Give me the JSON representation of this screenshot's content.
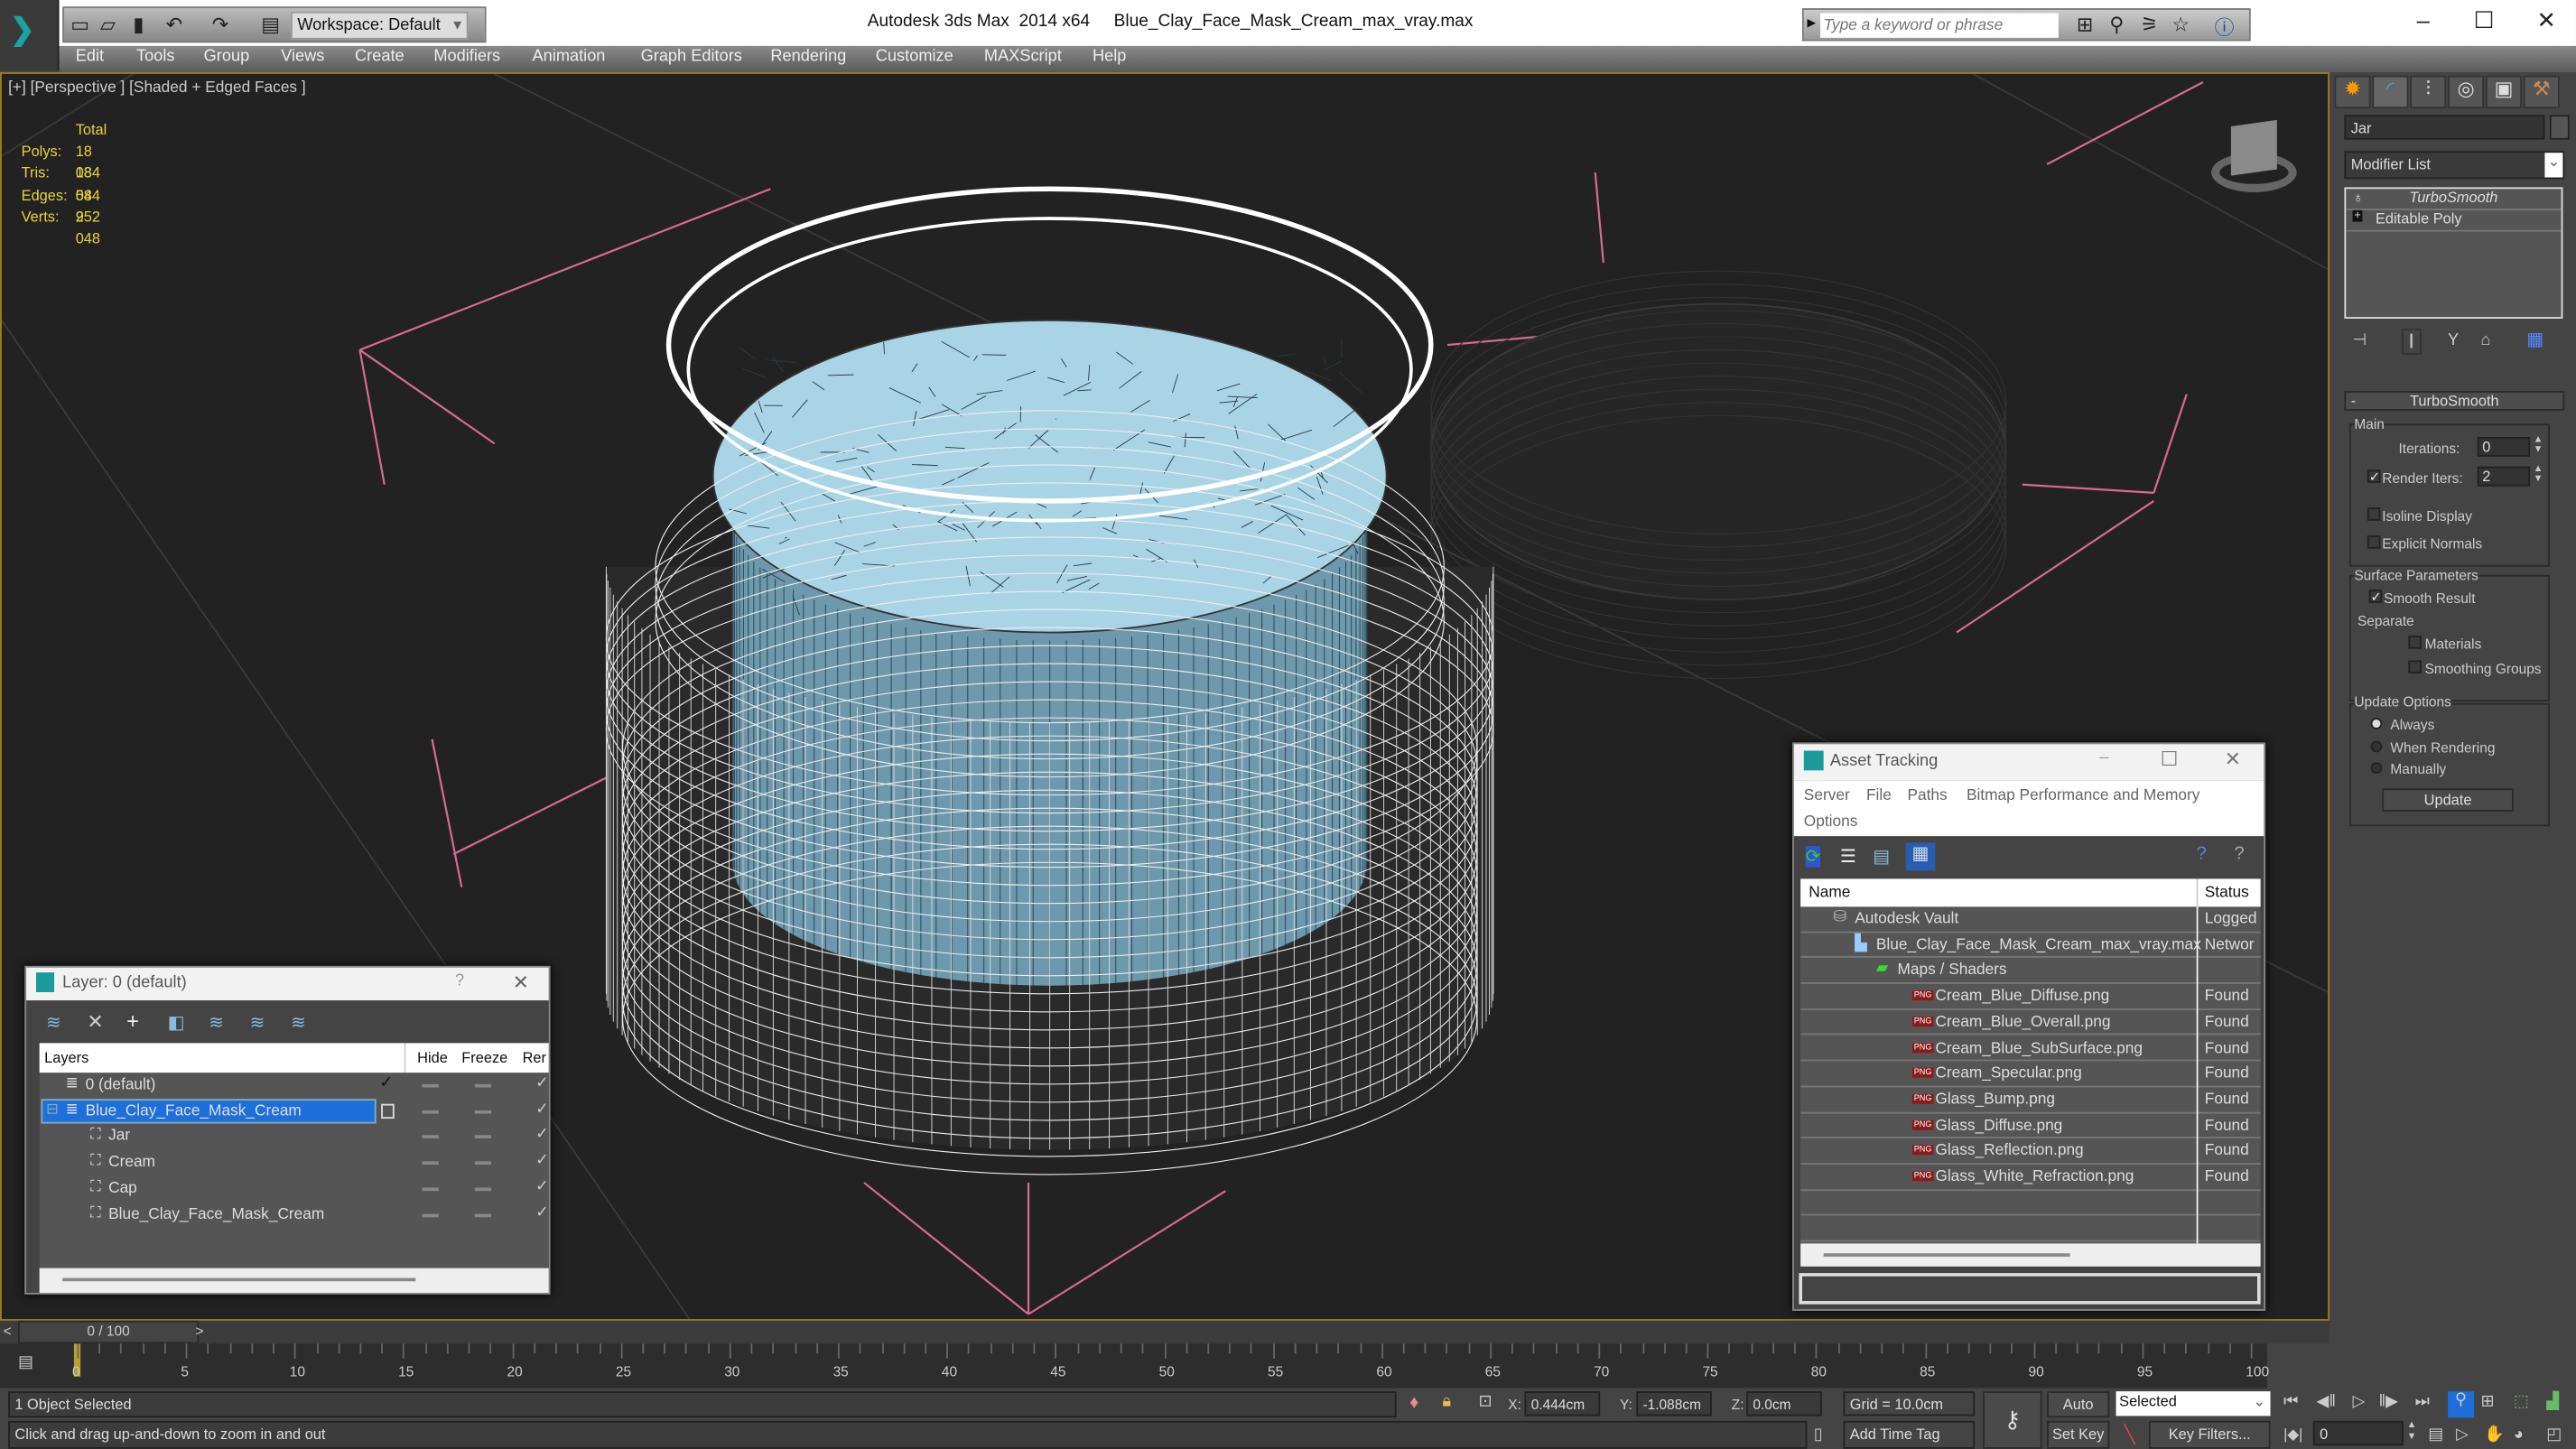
{
  "app": {
    "title": "Autodesk 3ds Max  2014 x64",
    "file": "Blue_Clay_Face_Mask_Cream_max_vray.max",
    "workspace": "Workspace: Default",
    "search_placeholder": "Type a keyword or phrase"
  },
  "menu": [
    "Edit",
    "Tools",
    "Group",
    "Views",
    "Create",
    "Modifiers",
    "Animation",
    "Graph Editors",
    "Rendering",
    "Customize",
    "MAXScript",
    "Help"
  ],
  "viewport": {
    "label": "[+] [Perspective ] [Shaded + Edged Faces ]",
    "stats": {
      "header": "Total",
      "rows": [
        {
          "k": "Polys:",
          "v": "18 084"
        },
        {
          "k": "Tris:",
          "v": "18 084"
        },
        {
          "k": "Edges:",
          "v": "54 252"
        },
        {
          "k": "Verts:",
          "v": "9 048"
        }
      ]
    }
  },
  "command_panel": {
    "object_name": "Jar",
    "modifier_list": "Modifier List",
    "stack": [
      "TurboSmooth",
      "Editable Poly"
    ],
    "rollout": {
      "title": "TurboSmooth",
      "main": "Main",
      "iterations_label": "Iterations:",
      "iterations": "0",
      "render_iters_label": "Render Iters:",
      "render_iters": "2",
      "render_iters_checked": true,
      "isoline": "Isoline Display",
      "explicit_normals": "Explicit Normals",
      "surface": "Surface Parameters",
      "smooth_result": "Smooth Result",
      "smooth_result_checked": true,
      "separate": "Separate",
      "materials": "Materials",
      "smoothing_groups": "Smoothing Groups",
      "update_options": "Update Options",
      "always": "Always",
      "when_rendering": "When Rendering",
      "manually": "Manually",
      "selected_update": "Always",
      "update_btn": "Update"
    }
  },
  "layer_dialog": {
    "title": "Layer: 0 (default)",
    "help": "?",
    "columns": [
      "Layers",
      "Hide",
      "Freeze",
      "Rer"
    ],
    "rows": [
      {
        "name": "0 (default)",
        "level": 0,
        "active": true
      },
      {
        "name": "Blue_Clay_Face_Mask_Cream",
        "level": 0,
        "selected": true
      },
      {
        "name": "Jar",
        "level": 1
      },
      {
        "name": "Cream",
        "level": 1
      },
      {
        "name": "Cap",
        "level": 1
      },
      {
        "name": "Blue_Clay_Face_Mask_Cream",
        "level": 1
      }
    ]
  },
  "asset_tracking": {
    "title": "Asset Tracking",
    "menu": [
      "Server",
      "File",
      "Paths",
      "Bitmap Performance and Memory",
      "Options"
    ],
    "columns": [
      "Name",
      "Status"
    ],
    "rows": [
      {
        "name": "Autodesk Vault",
        "status": "Logged",
        "level": 0,
        "icon": "vault"
      },
      {
        "name": "Blue_Clay_Face_Mask_Cream_max_vray.max",
        "status": "Networ",
        "level": 1,
        "icon": "max"
      },
      {
        "name": "Maps / Shaders",
        "status": "",
        "level": 2,
        "icon": "maps"
      },
      {
        "name": "Cream_Blue_Diffuse.png",
        "status": "Found",
        "level": 3,
        "icon": "png"
      },
      {
        "name": "Cream_Blue_Overall.png",
        "status": "Found",
        "level": 3,
        "icon": "png"
      },
      {
        "name": "Cream_Blue_SubSurface.png",
        "status": "Found",
        "level": 3,
        "icon": "png"
      },
      {
        "name": "Cream_Specular.png",
        "status": "Found",
        "level": 3,
        "icon": "png"
      },
      {
        "name": "Glass_Bump.png",
        "status": "Found",
        "level": 3,
        "icon": "png"
      },
      {
        "name": "Glass_Diffuse.png",
        "status": "Found",
        "level": 3,
        "icon": "png"
      },
      {
        "name": "Glass_Reflection.png",
        "status": "Found",
        "level": 3,
        "icon": "png"
      },
      {
        "name": "Glass_White_Refraction.png",
        "status": "Found",
        "level": 3,
        "icon": "png"
      }
    ]
  },
  "timeline": {
    "frame": "0 / 100",
    "ticks": [
      "0",
      "5",
      "10",
      "15",
      "20",
      "25",
      "30",
      "35",
      "40",
      "45",
      "50",
      "55",
      "60",
      "65",
      "70",
      "75",
      "80",
      "85",
      "90",
      "95",
      "100"
    ]
  },
  "status": {
    "selection": "1 Object Selected",
    "prompt": "Click and drag up-and-down to zoom in and out",
    "x_label": "X:",
    "x": "0.444cm",
    "y_label": "Y:",
    "y": "-1.088cm",
    "z_label": "Z:",
    "z": "0.0cm",
    "grid": "Grid = 10.0cm",
    "add_time_tag": "Add Time Tag",
    "auto_key": "Auto Key",
    "set_key": "Set Key",
    "key_mode": "Selected",
    "key_filters": "Key Filters...",
    "current_frame": "0"
  },
  "colors": {
    "accent": "#1e6fd9",
    "stats": "#e8d23a",
    "cream": "#a8d4e6",
    "viewport_border": "#a08020"
  }
}
